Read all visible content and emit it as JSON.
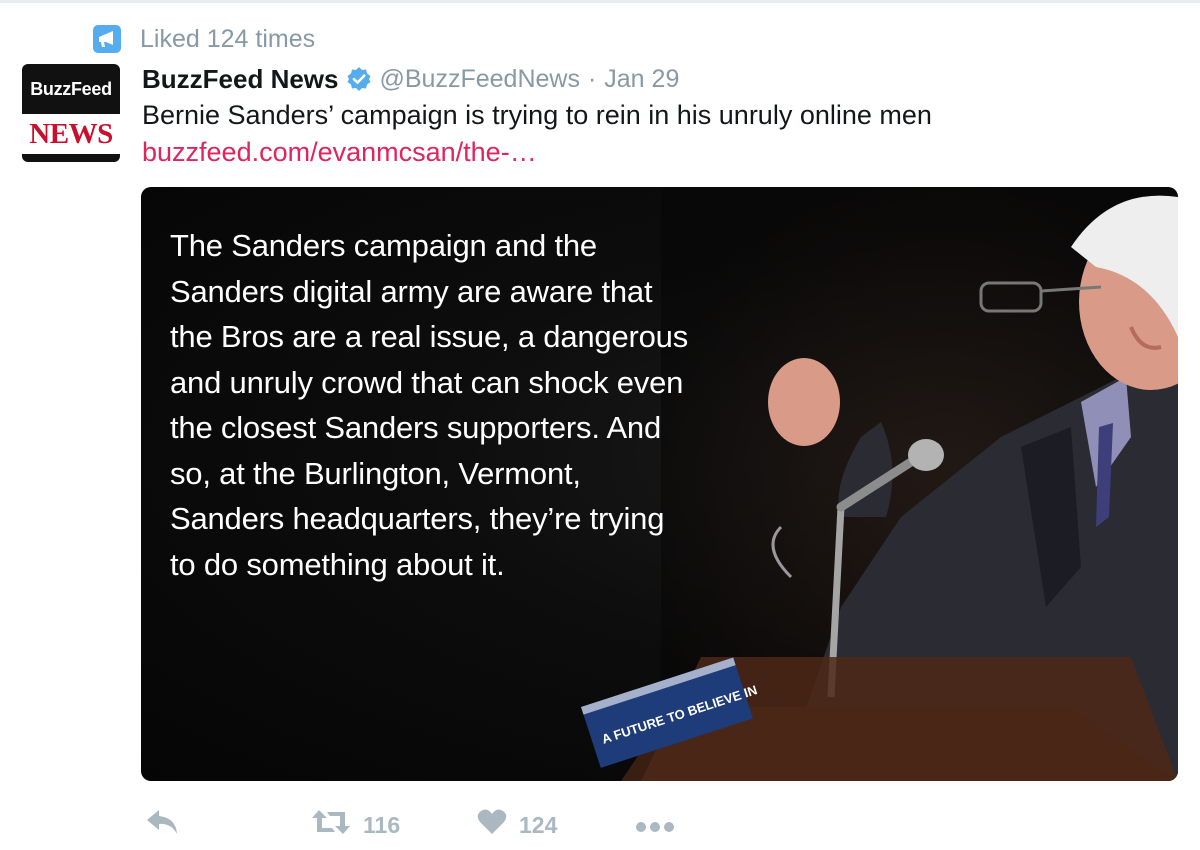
{
  "context": {
    "label": "Liked 124 times",
    "icon": "megaphone-icon",
    "icon_color": "#55acee"
  },
  "account": {
    "avatar_top": "BuzzFeed",
    "avatar_bottom": "NEWS",
    "name": "BuzzFeed News",
    "verified_icon": "verified-badge-icon",
    "handle": "@BuzzFeedNews",
    "separator": "·",
    "date": "Jan 29"
  },
  "tweet": {
    "text": "Bernie Sanders’ campaign is trying to rein in his unruly online men",
    "link": "buzzfeed.com/evanmcsan/the-…",
    "link_color": "#e0245e"
  },
  "media": {
    "quote": "The Sanders campaign and the Sanders digital army are aware that the Bros are a real issue, a dangerous and unruly crowd that can shock even the closest Sanders supporters. And so, at the Burlington, Vermont, Sanders headquarters, they’re trying to do something about it.",
    "sign_text": "A FUTURE TO BELIEVE IN"
  },
  "actions": {
    "reply_icon": "reply-icon",
    "retweet_icon": "retweet-icon",
    "retweet_count": "116",
    "like_icon": "heart-icon",
    "like_count": "124",
    "more_icon": "more-dots-icon"
  }
}
